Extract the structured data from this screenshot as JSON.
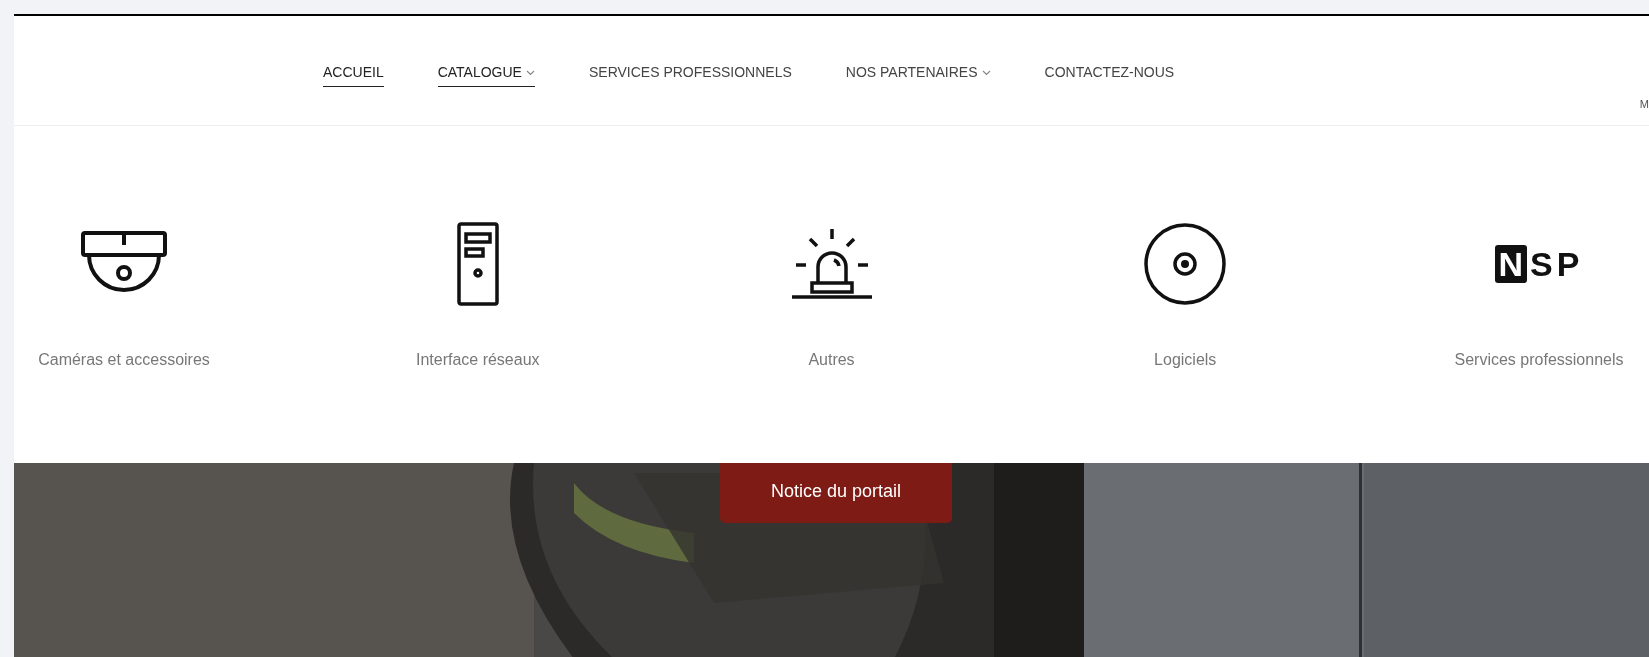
{
  "nav": {
    "items": [
      {
        "label": "ACCUEIL",
        "underlined": true,
        "has_dropdown": false
      },
      {
        "label": "CATALOGUE",
        "underlined": true,
        "has_dropdown": true
      },
      {
        "label": "SERVICES PROFESSIONNELS",
        "underlined": false,
        "has_dropdown": false
      },
      {
        "label": "NOS PARTENAIRES",
        "underlined": false,
        "has_dropdown": true
      },
      {
        "label": "CONTACTEZ-NOUS",
        "underlined": false,
        "has_dropdown": false
      }
    ],
    "edge_text": "M"
  },
  "catalogue_menu": {
    "items": [
      {
        "kind": "dome-camera",
        "label": "Caméras et accessoires"
      },
      {
        "kind": "server",
        "label": "Interface réseaux"
      },
      {
        "kind": "alarm",
        "label": "Autres"
      },
      {
        "kind": "disc",
        "label": "Logiciels"
      },
      {
        "kind": "logo",
        "logo_boxed": "N",
        "logo_rest": "SP",
        "label": "Services professionnels"
      }
    ]
  },
  "hero": {
    "kind": "picture",
    "button": "Notice du portail"
  }
}
